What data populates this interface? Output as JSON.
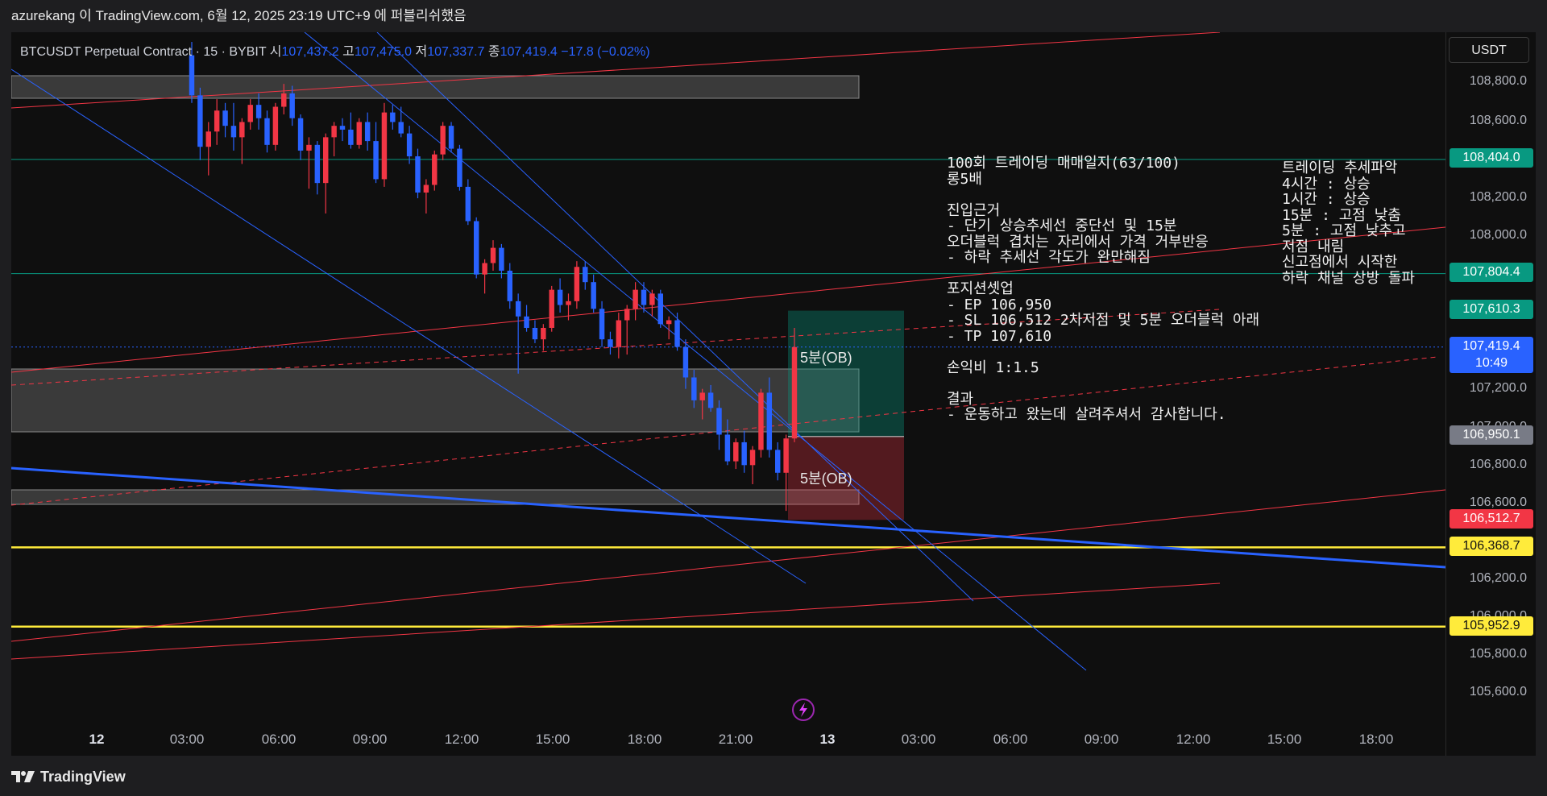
{
  "header": {
    "attribution": "azurekang 이 TradingView.com, 6월 12, 2025 23:19 UTC+9 에 퍼블리쉬했음"
  },
  "symbol": {
    "name": "BTCUSDT Perpetual Contract · 15 · BYBIT",
    "open_label": "시",
    "open": "107,437.2",
    "high_label": "고",
    "high": "107,475.0",
    "low_label": "저",
    "low": "107,337.7",
    "close_label": "종",
    "close": "107,419.4",
    "change": "−17.8 (−0.02%)"
  },
  "currency_button": "USDT",
  "price_axis": {
    "ticks": [
      "108,800.0",
      "108,600.0",
      "108,200.0",
      "108,000.0",
      "107,200.0",
      "107,000.0",
      "106,800.0",
      "106,600.0",
      "106,200.0",
      "106,000.0",
      "105,800.0",
      "105,600.0"
    ],
    "tags": {
      "level_108404": "108,404.0",
      "level_107804": "107,804.4",
      "target": "107,610.3",
      "current_price": "107,419.4",
      "current_countdown": "10:49",
      "entry": "106,950.1",
      "stop": "106,512.7",
      "yellow_high": "106,368.7",
      "yellow_low": "105,952.9"
    },
    "colors": {
      "teal": "#089981",
      "blue": "#2962ff",
      "gray": "#787b86",
      "red": "#f23645",
      "yellow": "#ffeb3b"
    }
  },
  "time_axis": {
    "labels": [
      "12",
      "03:00",
      "06:00",
      "09:00",
      "12:00",
      "15:00",
      "18:00",
      "21:00",
      "13",
      "03:00",
      "06:00",
      "09:00",
      "12:00",
      "15:00",
      "18:00"
    ]
  },
  "notes": {
    "journal": "100회 트레이딩 매매일지(63/100)\n롱5배\n\n진입근거\n- 단기 상승추세선 중단선 및 15분\n오더블럭 겹치는 자리에서 가격 거부반응\n- 하락 추세선 각도가 완만해짐\n\n포지션셋업\n- EP 106,950\n- SL 106,512 2차저점 및 5분 오더블럭 아래\n- TP 107,610\n\n손익비 1:1.5\n\n결과\n- 운동하고 왔는데 살려주셔서 감사합니다.",
    "trend": "트레이딩 추세파악\n4시간 : 상승\n1시간 : 상승\n15분 : 고점 낮춤\n5분 : 고점 낮추고\n저점 내림\n신고점에서 시작한\n하락 채널 상방 돌파"
  },
  "ob_labels": {
    "upper": "5분(OB)",
    "lower": "5분(OB)"
  },
  "icons": {
    "bolt": "lightning-bolt-icon",
    "logo": "tradingview-logo-icon"
  },
  "footer": {
    "brand": "TradingView"
  },
  "chart_data": {
    "type": "candlestick",
    "title": "",
    "ylim": [
      105500,
      109000
    ],
    "candle_colors": {
      "up": "#f23645",
      "down": "#2962ff"
    },
    "candles": [
      [
        108950,
        109020,
        108700,
        108740
      ],
      [
        108740,
        108780,
        108400,
        108470
      ],
      [
        108470,
        108600,
        108320,
        108550
      ],
      [
        108550,
        108720,
        108480,
        108660
      ],
      [
        108660,
        108700,
        108520,
        108580
      ],
      [
        108580,
        108700,
        108450,
        108520
      ],
      [
        108520,
        108620,
        108380,
        108600
      ],
      [
        108600,
        108720,
        108560,
        108690
      ],
      [
        108690,
        108750,
        108560,
        108620
      ],
      [
        108620,
        108660,
        108440,
        108480
      ],
      [
        108480,
        108700,
        108450,
        108680
      ],
      [
        108680,
        108800,
        108640,
        108750
      ],
      [
        108750,
        108790,
        108580,
        108620
      ],
      [
        108620,
        108640,
        108400,
        108450
      ],
      [
        108450,
        108520,
        108250,
        108480
      ],
      [
        108480,
        108500,
        108220,
        108280
      ],
      [
        108280,
        108540,
        108120,
        108520
      ],
      [
        108520,
        108600,
        108420,
        108580
      ],
      [
        108580,
        108620,
        108500,
        108560
      ],
      [
        108560,
        108650,
        108460,
        108480
      ],
      [
        108480,
        108620,
        108460,
        108600
      ],
      [
        108600,
        108650,
        108450,
        108500
      ],
      [
        108500,
        108600,
        108280,
        108300
      ],
      [
        108300,
        108700,
        108260,
        108650
      ],
      [
        108650,
        108690,
        108560,
        108600
      ],
      [
        108600,
        108680,
        108520,
        108540
      ],
      [
        108540,
        108580,
        108380,
        108420
      ],
      [
        108420,
        108460,
        108200,
        108230
      ],
      [
        108230,
        108300,
        108120,
        108270
      ],
      [
        108270,
        108450,
        108240,
        108430
      ],
      [
        108430,
        108600,
        108400,
        108580
      ],
      [
        108580,
        108600,
        108440,
        108460
      ],
      [
        108460,
        108480,
        108240,
        108260
      ],
      [
        108260,
        108300,
        108060,
        108080
      ],
      [
        108080,
        108100,
        107780,
        107800
      ],
      [
        107800,
        107880,
        107700,
        107860
      ],
      [
        107860,
        107980,
        107820,
        107940
      ],
      [
        107940,
        107960,
        107780,
        107820
      ],
      [
        107820,
        107860,
        107620,
        107660
      ],
      [
        107660,
        107700,
        107280,
        107580
      ],
      [
        107580,
        107640,
        107500,
        107520
      ],
      [
        107520,
        107560,
        107440,
        107460
      ],
      [
        107460,
        107540,
        107400,
        107520
      ],
      [
        107520,
        107740,
        107500,
        107720
      ],
      [
        107720,
        107780,
        107600,
        107640
      ],
      [
        107640,
        107700,
        107560,
        107660
      ],
      [
        107660,
        107870,
        107620,
        107840
      ],
      [
        107840,
        107870,
        107720,
        107760
      ],
      [
        107760,
        107800,
        107600,
        107620
      ],
      [
        107620,
        107660,
        107420,
        107460
      ],
      [
        107460,
        107500,
        107380,
        107420
      ],
      [
        107420,
        107600,
        107360,
        107560
      ],
      [
        107560,
        107640,
        107380,
        107620
      ],
      [
        107620,
        107760,
        107560,
        107720
      ],
      [
        107720,
        107760,
        107600,
        107640
      ],
      [
        107640,
        107720,
        107580,
        107700
      ],
      [
        107700,
        107720,
        107520,
        107540
      ],
      [
        107540,
        107580,
        107460,
        107560
      ],
      [
        107560,
        107600,
        107400,
        107420
      ],
      [
        107420,
        107460,
        107200,
        107260
      ],
      [
        107260,
        107300,
        107100,
        107140
      ],
      [
        107140,
        107200,
        107040,
        107180
      ],
      [
        107180,
        107220,
        107080,
        107100
      ],
      [
        107100,
        107140,
        106880,
        106960
      ],
      [
        106960,
        107040,
        106800,
        106820
      ],
      [
        106820,
        106940,
        106780,
        106920
      ],
      [
        106920,
        106980,
        106760,
        106800
      ],
      [
        106800,
        106900,
        106700,
        106880
      ],
      [
        106880,
        107200,
        106840,
        107180
      ],
      [
        107180,
        107260,
        106840,
        106880
      ],
      [
        106880,
        106920,
        106720,
        106760
      ],
      [
        106760,
        106960,
        106560,
        106940
      ],
      [
        106940,
        107520,
        106920,
        107419.4
      ]
    ],
    "horizontal_levels": [
      {
        "price": 108404.0,
        "color": "#089981"
      },
      {
        "price": 107804.4,
        "color": "#089981"
      },
      {
        "price": 106368.7,
        "color": "#ffeb3b"
      },
      {
        "price": 105952.9,
        "color": "#ffeb3b"
      }
    ],
    "position": {
      "entry": 106950.1,
      "stop": 106512.7,
      "target": 107610.3
    }
  }
}
